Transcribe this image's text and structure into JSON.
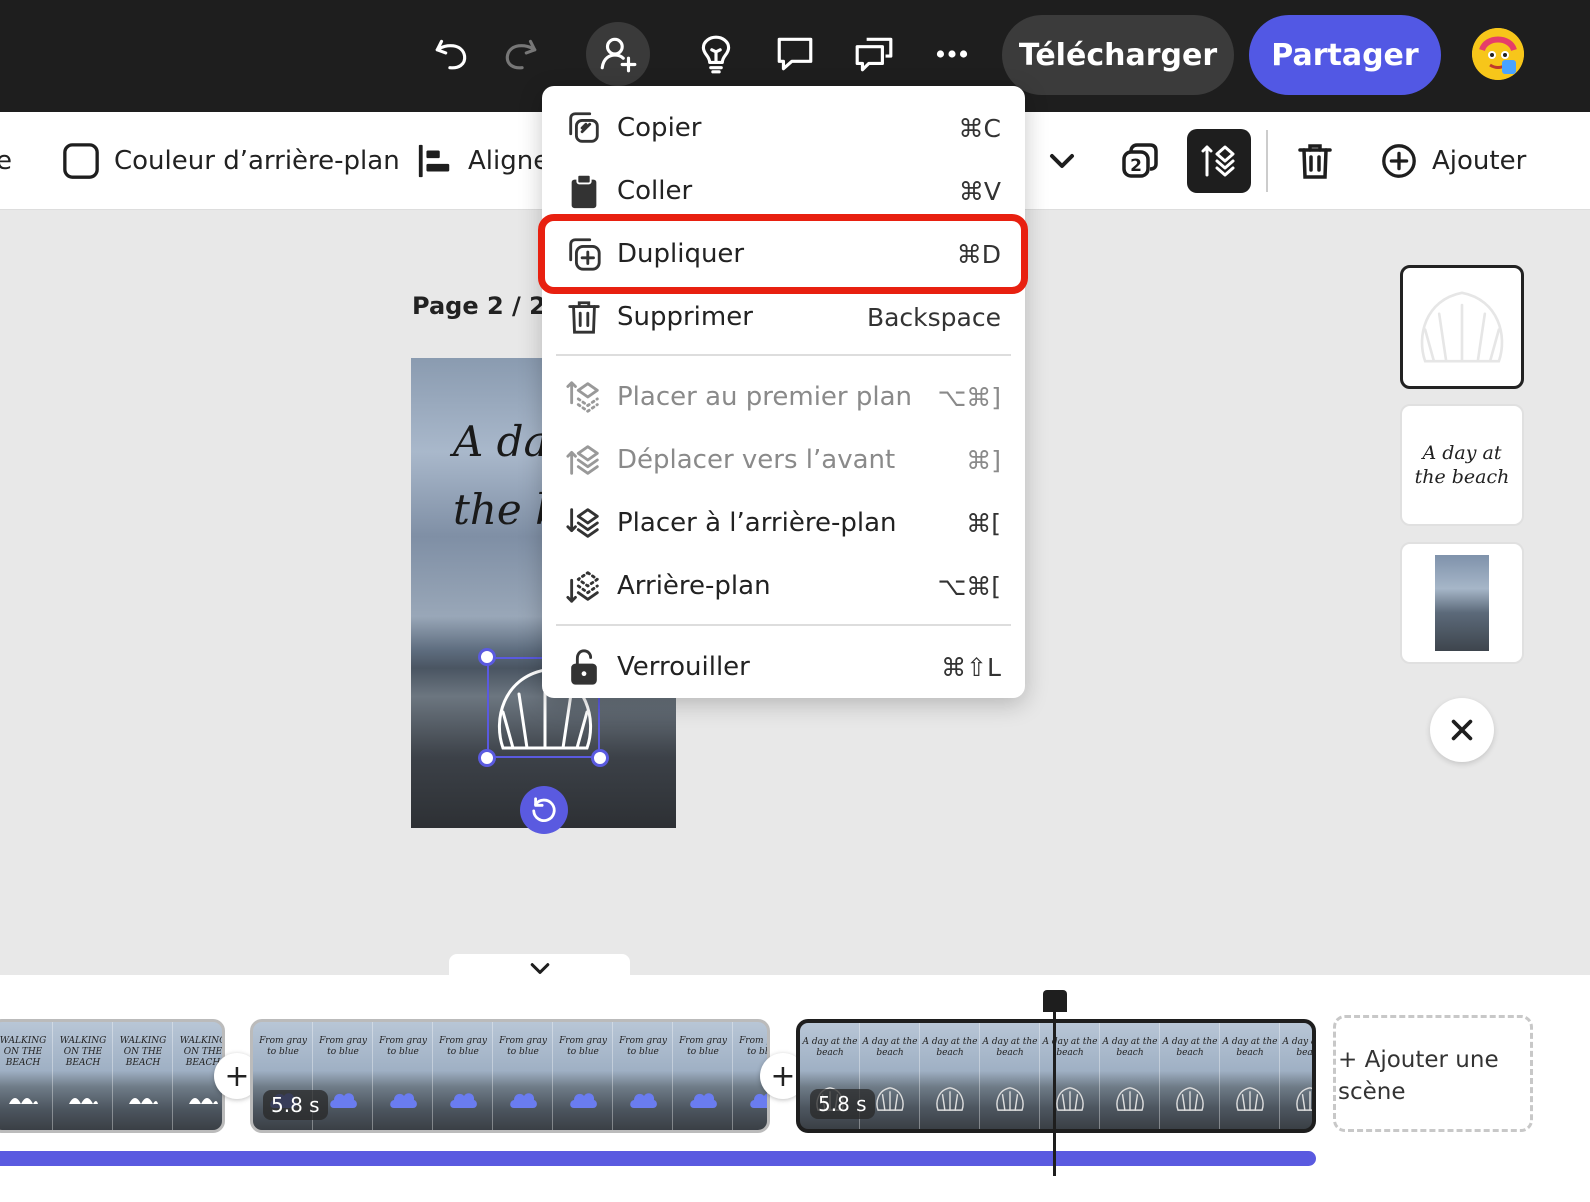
{
  "topbar": {
    "download_label": "Télécharger",
    "share_label": "Partager",
    "icons": [
      "undo-icon",
      "redo-icon",
      "add-collaborator-icon",
      "lightbulb-icon",
      "comment-icon",
      "comments-icon",
      "more-icon"
    ]
  },
  "toolbar": {
    "partial_left": "e",
    "background_color_label": "Couleur d’arrière-plan",
    "align_label": "Aligner",
    "add_label": "Ajouter",
    "layers_badge": "2"
  },
  "canvas": {
    "page_label": "Page 2 / 2 -",
    "title_line1": "A day at",
    "title_line2": "the beach"
  },
  "context_menu": {
    "items": [
      {
        "label": "Copier",
        "shortcut": "⌘C",
        "enabled": true
      },
      {
        "label": "Coller",
        "shortcut": "⌘V",
        "enabled": true
      },
      {
        "label": "Dupliquer",
        "shortcut": "⌘D",
        "enabled": true,
        "highlighted": true
      },
      {
        "label": "Supprimer",
        "shortcut": "Backspace",
        "enabled": true
      },
      {
        "label": "Placer au premier plan",
        "shortcut": "⌥⌘]",
        "enabled": false
      },
      {
        "label": "Déplacer vers l’avant",
        "shortcut": "⌘]",
        "enabled": false
      },
      {
        "label": "Placer à l’arrière-plan",
        "shortcut": "⌘[",
        "enabled": true
      },
      {
        "label": "Arrière-plan",
        "shortcut": "⌥⌘[",
        "enabled": true
      },
      {
        "label": "Verrouiller",
        "shortcut": "⌘⇧L",
        "enabled": true
      }
    ]
  },
  "layers_panel": {
    "text_thumb_line1": "A day at",
    "text_thumb_line2": "the beach"
  },
  "timeline": {
    "clip1_frame_text": "WALKING ON THE BEACH",
    "clip2_duration": "5.8 s",
    "clip2_frame_text": "From gray to blue",
    "clip3_duration": "5.8 s",
    "clip3_frame_text": "A day at the beach",
    "add_scene_line1": "+ Ajouter une",
    "add_scene_line2": "scène"
  },
  "colors": {
    "accent": "#5258e4",
    "highlight": "#e82010",
    "topbar_bg": "#1e1e1e"
  }
}
